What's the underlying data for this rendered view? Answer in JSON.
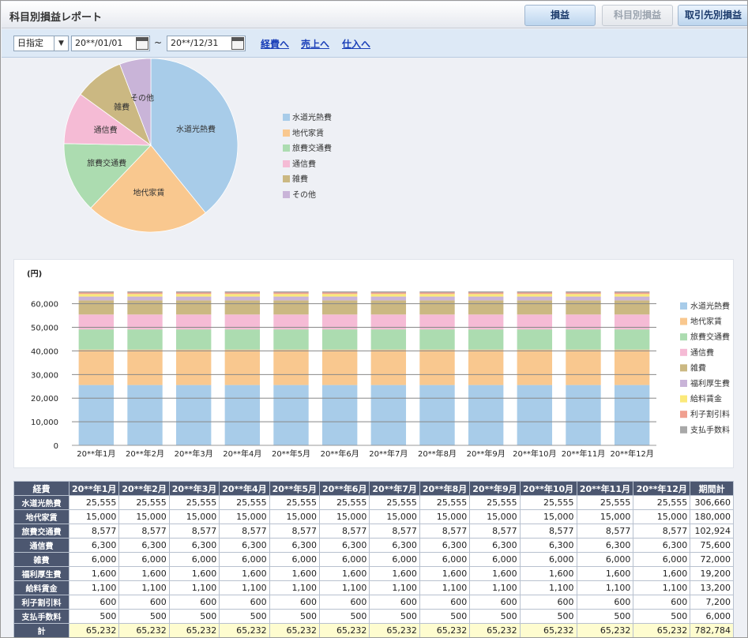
{
  "app": {
    "title": "科目別損益レポート",
    "buttons": [
      {
        "label": "損益",
        "state": "active"
      },
      {
        "label": "科目別損益",
        "state": "disabled"
      },
      {
        "label": "取引先別損益",
        "state": "active"
      }
    ]
  },
  "filter": {
    "mode": "日指定",
    "date_from": "20**/01/01",
    "date_to": "20**/12/31",
    "separator": "~",
    "links": [
      "経費へ",
      "売上へ",
      "仕入へ"
    ]
  },
  "pie_chart": {
    "type": "pie",
    "slices": [
      {
        "label": "水道光熱費",
        "value": 306660,
        "color": "#a8cce9"
      },
      {
        "label": "地代家賃",
        "value": 180000,
        "color": "#f9c88f"
      },
      {
        "label": "旅費交通費",
        "value": 102924,
        "color": "#acdcb0"
      },
      {
        "label": "通信費",
        "value": 75600,
        "color": "#f5bbd5"
      },
      {
        "label": "雑費",
        "value": 72000,
        "color": "#cbb882"
      },
      {
        "label": "その他",
        "value": 45600,
        "color": "#c9b4d8"
      }
    ]
  },
  "chart_data": {
    "type": "bar",
    "stacked": true,
    "ylabel": "(円)",
    "ylim": [
      0,
      65232
    ],
    "yticks": [
      "0",
      "10,000",
      "20,000",
      "30,000",
      "40,000",
      "50,000",
      "60,000"
    ],
    "ytick_values": [
      0,
      10000,
      20000,
      30000,
      40000,
      50000,
      60000
    ],
    "grid": true,
    "legend_position": "right",
    "categories": [
      "20**年1月",
      "20**年2月",
      "20**年3月",
      "20**年4月",
      "20**年5月",
      "20**年6月",
      "20**年7月",
      "20**年8月",
      "20**年9月",
      "20**年10月",
      "20**年11月",
      "20**年12月"
    ],
    "series": [
      {
        "name": "水道光熱費",
        "color": "#a8cce9",
        "values": [
          25555,
          25555,
          25555,
          25555,
          25555,
          25555,
          25555,
          25555,
          25555,
          25555,
          25555,
          25555
        ]
      },
      {
        "name": "地代家賃",
        "color": "#f9c88f",
        "values": [
          15000,
          15000,
          15000,
          15000,
          15000,
          15000,
          15000,
          15000,
          15000,
          15000,
          15000,
          15000
        ]
      },
      {
        "name": "旅費交通費",
        "color": "#acdcb0",
        "values": [
          8577,
          8577,
          8577,
          8577,
          8577,
          8577,
          8577,
          8577,
          8577,
          8577,
          8577,
          8577
        ]
      },
      {
        "name": "通信費",
        "color": "#f5bbd5",
        "values": [
          6300,
          6300,
          6300,
          6300,
          6300,
          6300,
          6300,
          6300,
          6300,
          6300,
          6300,
          6300
        ]
      },
      {
        "name": "雑費",
        "color": "#cbb882",
        "values": [
          6000,
          6000,
          6000,
          6000,
          6000,
          6000,
          6000,
          6000,
          6000,
          6000,
          6000,
          6000
        ]
      },
      {
        "name": "福利厚生費",
        "color": "#c9b4d8",
        "values": [
          1600,
          1600,
          1600,
          1600,
          1600,
          1600,
          1600,
          1600,
          1600,
          1600,
          1600,
          1600
        ]
      },
      {
        "name": "給料賃金",
        "color": "#fbe97a",
        "values": [
          1100,
          1100,
          1100,
          1100,
          1100,
          1100,
          1100,
          1100,
          1100,
          1100,
          1100,
          1100
        ]
      },
      {
        "name": "利子割引料",
        "color": "#f0a090",
        "values": [
          600,
          600,
          600,
          600,
          600,
          600,
          600,
          600,
          600,
          600,
          600,
          600
        ]
      },
      {
        "name": "支払手数料",
        "color": "#a8a8a8",
        "values": [
          500,
          500,
          500,
          500,
          500,
          500,
          500,
          500,
          500,
          500,
          500,
          500
        ]
      }
    ]
  },
  "table": {
    "headers": [
      "経費",
      "20**年1月",
      "20**年2月",
      "20**年3月",
      "20**年4月",
      "20**年5月",
      "20**年6月",
      "20**年7月",
      "20**年8月",
      "20**年9月",
      "20**年10月",
      "20**年11月",
      "20**年12月",
      "期間計"
    ],
    "rows": [
      {
        "label": "水道光熱費",
        "values": [
          "25,555",
          "25,555",
          "25,555",
          "25,555",
          "25,555",
          "25,555",
          "25,555",
          "25,555",
          "25,555",
          "25,555",
          "25,555",
          "25,555",
          "306,660"
        ]
      },
      {
        "label": "地代家賃",
        "values": [
          "15,000",
          "15,000",
          "15,000",
          "15,000",
          "15,000",
          "15,000",
          "15,000",
          "15,000",
          "15,000",
          "15,000",
          "15,000",
          "15,000",
          "180,000"
        ]
      },
      {
        "label": "旅費交通費",
        "values": [
          "8,577",
          "8,577",
          "8,577",
          "8,577",
          "8,577",
          "8,577",
          "8,577",
          "8,577",
          "8,577",
          "8,577",
          "8,577",
          "8,577",
          "102,924"
        ]
      },
      {
        "label": "通信費",
        "values": [
          "6,300",
          "6,300",
          "6,300",
          "6,300",
          "6,300",
          "6,300",
          "6,300",
          "6,300",
          "6,300",
          "6,300",
          "6,300",
          "6,300",
          "75,600"
        ]
      },
      {
        "label": "雑費",
        "values": [
          "6,000",
          "6,000",
          "6,000",
          "6,000",
          "6,000",
          "6,000",
          "6,000",
          "6,000",
          "6,000",
          "6,000",
          "6,000",
          "6,000",
          "72,000"
        ]
      },
      {
        "label": "福利厚生費",
        "values": [
          "1,600",
          "1,600",
          "1,600",
          "1,600",
          "1,600",
          "1,600",
          "1,600",
          "1,600",
          "1,600",
          "1,600",
          "1,600",
          "1,600",
          "19,200"
        ]
      },
      {
        "label": "給料賃金",
        "values": [
          "1,100",
          "1,100",
          "1,100",
          "1,100",
          "1,100",
          "1,100",
          "1,100",
          "1,100",
          "1,100",
          "1,100",
          "1,100",
          "1,100",
          "13,200"
        ]
      },
      {
        "label": "利子割引料",
        "values": [
          "600",
          "600",
          "600",
          "600",
          "600",
          "600",
          "600",
          "600",
          "600",
          "600",
          "600",
          "600",
          "7,200"
        ]
      },
      {
        "label": "支払手数料",
        "values": [
          "500",
          "500",
          "500",
          "500",
          "500",
          "500",
          "500",
          "500",
          "500",
          "500",
          "500",
          "500",
          "6,000"
        ]
      }
    ],
    "total": {
      "label": "計",
      "values": [
        "65,232",
        "65,232",
        "65,232",
        "65,232",
        "65,232",
        "65,232",
        "65,232",
        "65,232",
        "65,232",
        "65,232",
        "65,232",
        "65,232",
        "782,784"
      ]
    }
  }
}
